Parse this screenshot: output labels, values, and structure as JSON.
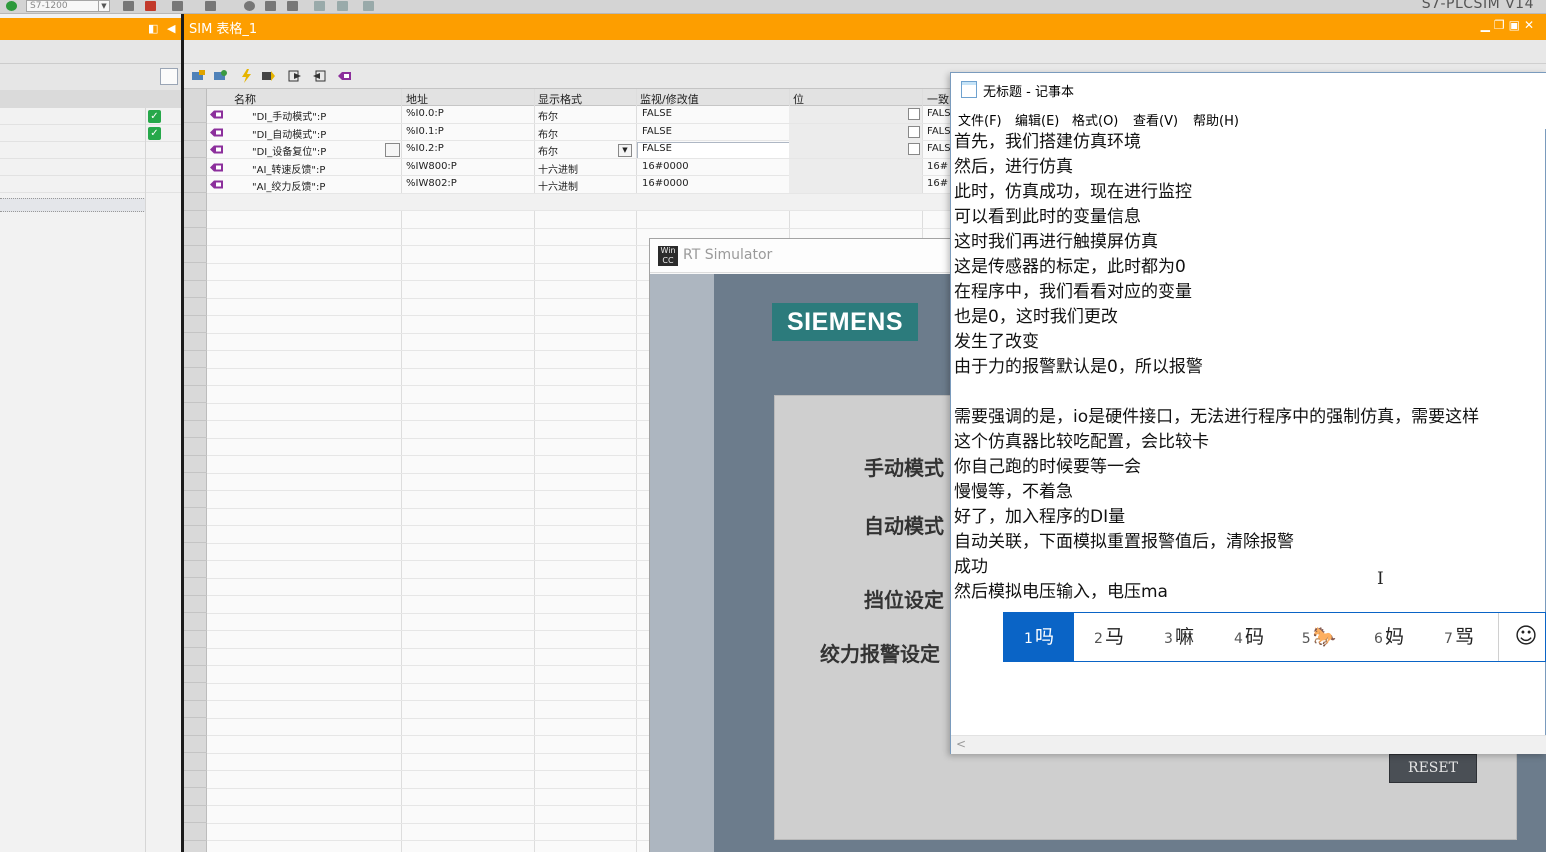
{
  "toolbar": {
    "cpu": "S7-1200",
    "app_title": "S7-PLCSIM V14"
  },
  "sim_window": {
    "title": "SIM 表格_1"
  },
  "table": {
    "columns": {
      "name": "名称",
      "address": "地址",
      "format": "显示格式",
      "monitor": "监视/修改值",
      "bit": "位",
      "consistent": "一致"
    },
    "rows": [
      {
        "name": "\"DI_手动模式\":P",
        "address": "%I0.0:P",
        "format": "布尔",
        "value": "FALSE",
        "consistent": "FALS"
      },
      {
        "name": "\"DI_自动模式\":P",
        "address": "%I0.1:P",
        "format": "布尔",
        "value": "FALSE",
        "consistent": "FALS"
      },
      {
        "name": "\"DI_设备复位\":P",
        "address": "%I0.2:P",
        "format": "布尔",
        "value": "FALSE",
        "consistent": "FALS"
      },
      {
        "name": "\"AI_转速反馈\":P",
        "address": "%IW800:P",
        "format": "十六进制",
        "value": "16#0000",
        "consistent": "16#"
      },
      {
        "name": "\"AI_绞力反馈\":P",
        "address": "%IW802:P",
        "format": "十六进制",
        "value": "16#0000",
        "consistent": "16#"
      }
    ]
  },
  "rt_simulator": {
    "title": "RT Simulator",
    "logo": "SIEMENS",
    "labels": [
      "手动模式",
      "自动模式",
      "挡位设定",
      "绞力报警设定"
    ],
    "reset_label": "RESET"
  },
  "notepad": {
    "title": "无标题 - 记事本",
    "menu": [
      "文件(F)",
      "编辑(E)",
      "格式(O)",
      "查看(V)",
      "帮助(H)"
    ],
    "lines": [
      "首先，我们搭建仿真环境",
      "然后，进行仿真",
      "此时，仿真成功，现在进行监控",
      "可以看到此时的变量信息",
      "这时我们再进行触摸屏仿真",
      "这是传感器的标定，此时都为0",
      "在程序中，我们看看对应的变量",
      "也是0，这时我们更改",
      "发生了改变",
      "由于力的报警默认是0，所以报警",
      "",
      "需要强调的是，io是硬件接口，无法进行程序中的强制仿真，需要这样",
      "这个仿真器比较吃配置，会比较卡",
      "你自己跑的时候要等一会",
      "慢慢等，不着急",
      "好了，加入程序的DI量",
      "自动关联，下面模拟重置报警值后，清除报警",
      "成功",
      "然后模拟电压输入，电压ma"
    ]
  },
  "ime": {
    "candidates": [
      {
        "num": "1",
        "text": "吗"
      },
      {
        "num": "2",
        "text": "马"
      },
      {
        "num": "3",
        "text": "嘛"
      },
      {
        "num": "4",
        "text": "码"
      },
      {
        "num": "5",
        "text": "🐎"
      },
      {
        "num": "6",
        "text": "妈"
      },
      {
        "num": "7",
        "text": "骂"
      }
    ],
    "emoji": "☺"
  }
}
